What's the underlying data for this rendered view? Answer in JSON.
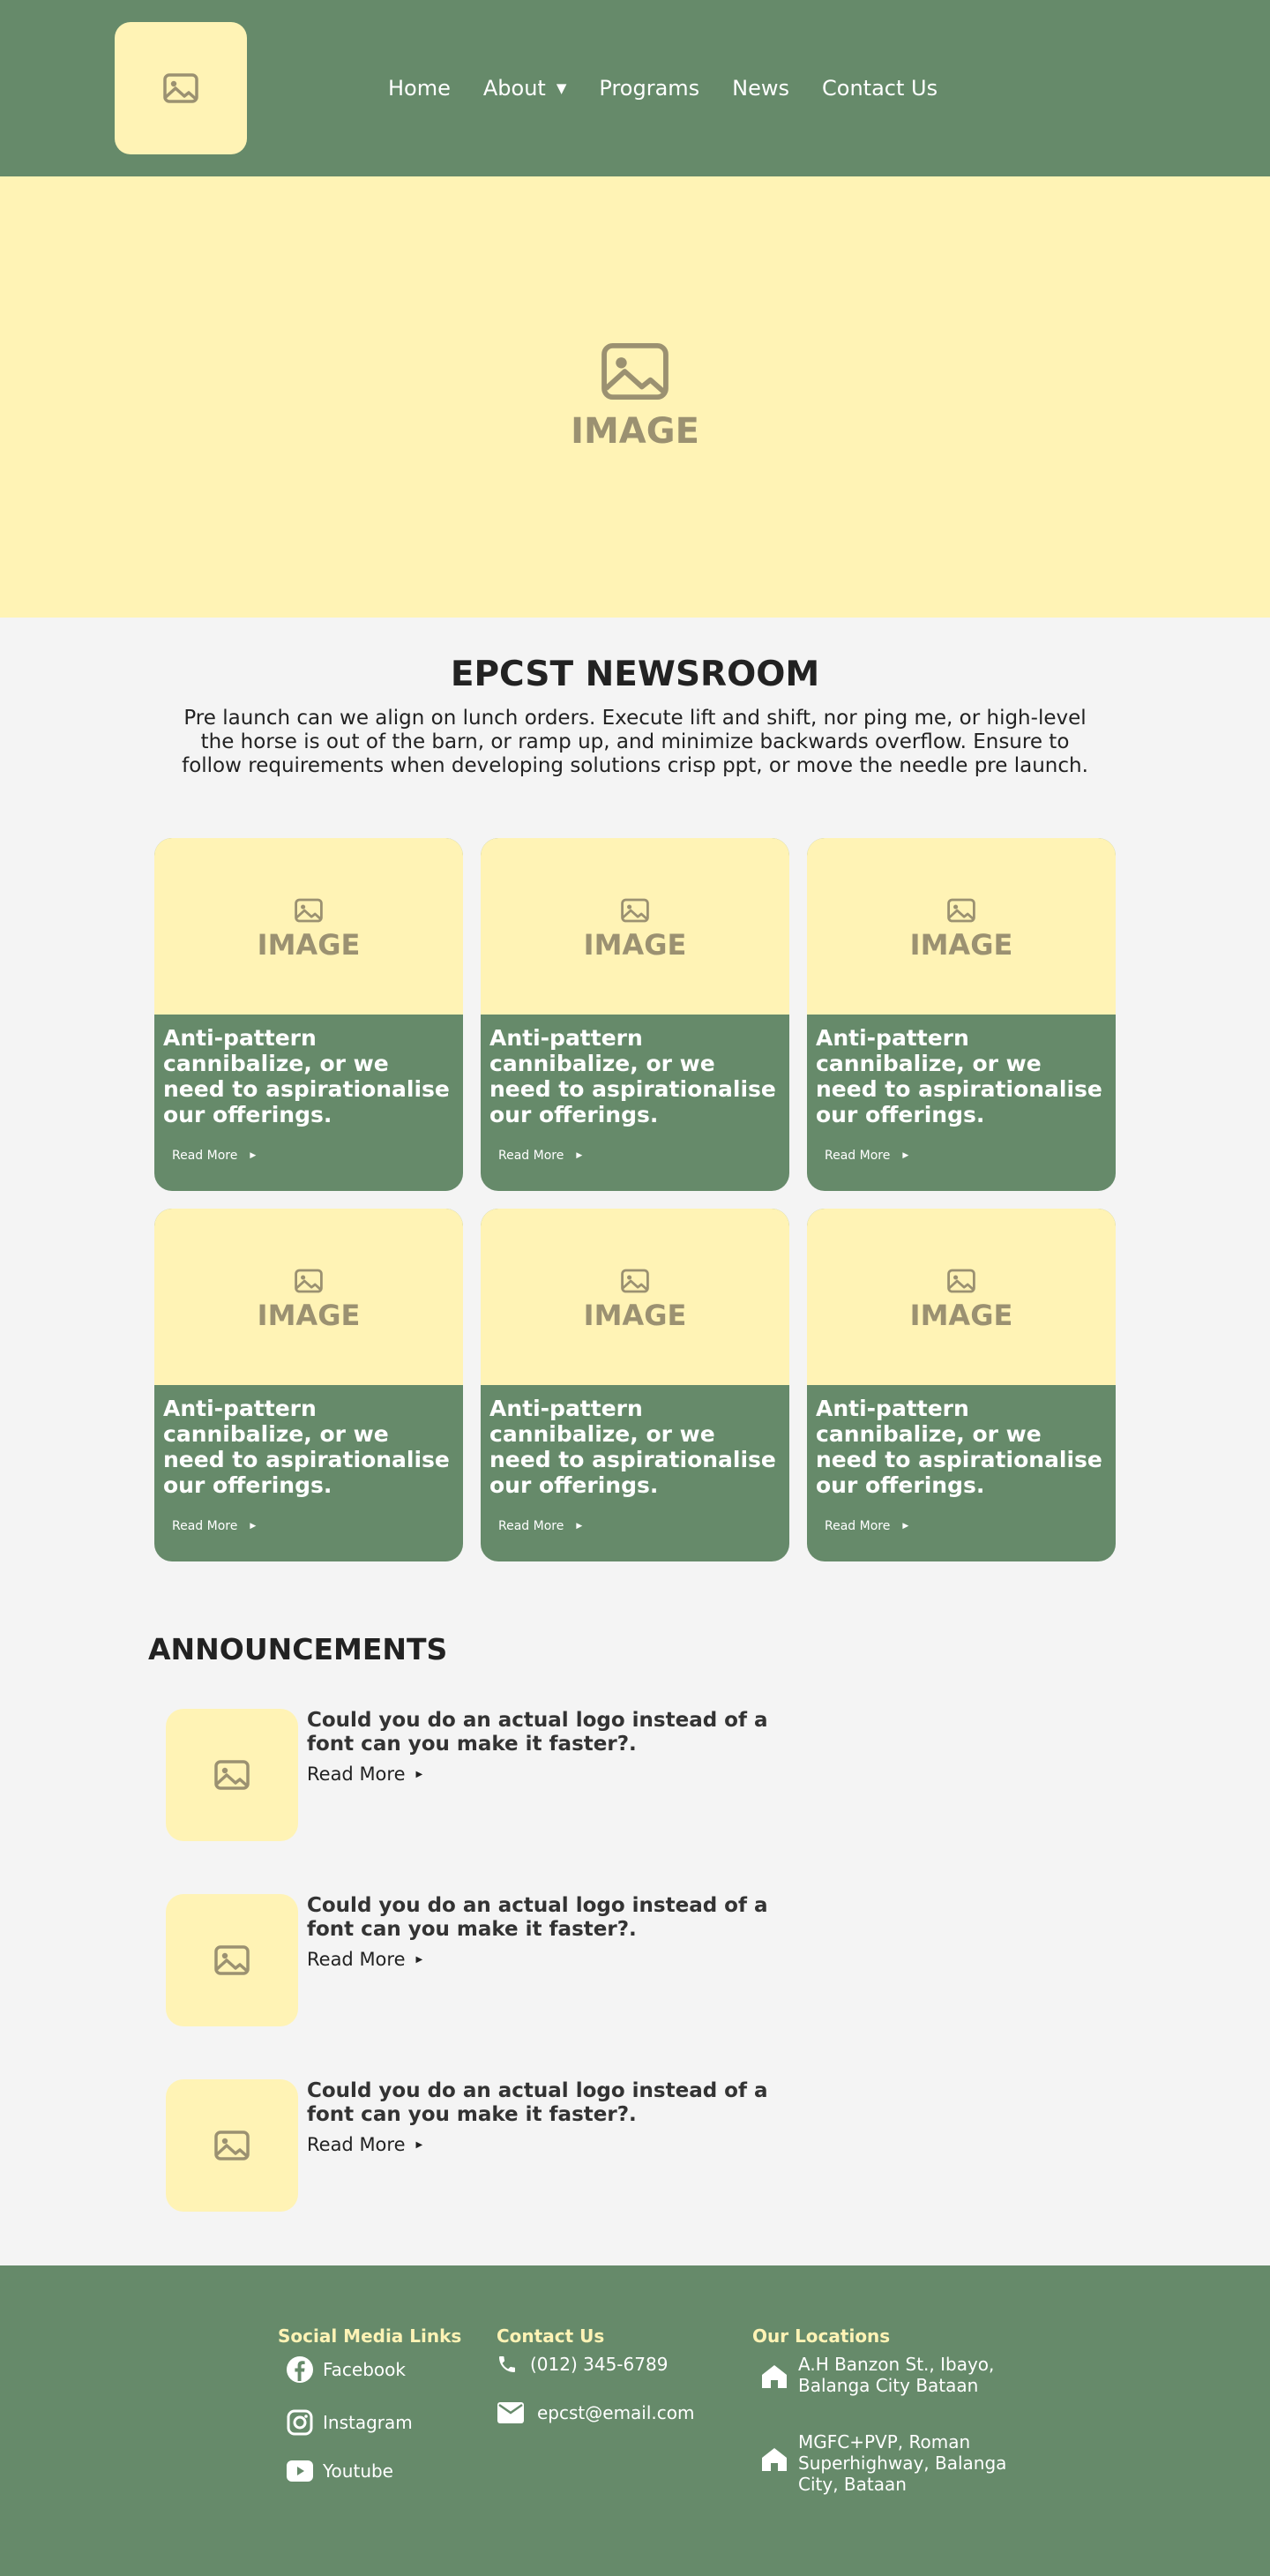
{
  "header": {
    "logo_icon": "image-placeholder-icon",
    "nav": [
      {
        "label": "Home"
      },
      {
        "label": "About",
        "has_dropdown": true
      },
      {
        "label": "Programs"
      },
      {
        "label": "News"
      },
      {
        "label": "Contact Us"
      }
    ]
  },
  "hero": {
    "label": "IMAGE",
    "icon": "image-placeholder-icon"
  },
  "newsroom": {
    "title": "EPCST NEWSROOM",
    "description": "Pre launch can we align on lunch orders. Execute lift and shift, nor ping me, or high-level the horse is out of the barn, or ramp up, and minimize backwards overflow. Ensure to follow requirements when developing solutions crisp ppt, or move the needle pre launch.",
    "cards": [
      {
        "image_label": "IMAGE",
        "title": "Anti-pattern cannibalize, or we need to aspirationalise our offerings.",
        "read_more": "Read More"
      },
      {
        "image_label": "IMAGE",
        "title": "Anti-pattern cannibalize, or we need to aspirationalise our offerings.",
        "read_more": "Read More"
      },
      {
        "image_label": "IMAGE",
        "title": "Anti-pattern cannibalize, or we need to aspirationalise our offerings.",
        "read_more": "Read More"
      },
      {
        "image_label": "IMAGE",
        "title": "Anti-pattern cannibalize, or we need to aspirationalise our offerings.",
        "read_more": "Read More"
      },
      {
        "image_label": "IMAGE",
        "title": "Anti-pattern cannibalize, or we need to aspirationalise our offerings.",
        "read_more": "Read More"
      },
      {
        "image_label": "IMAGE",
        "title": "Anti-pattern cannibalize, or we need to aspirationalise our offerings.",
        "read_more": "Read More"
      }
    ]
  },
  "announcements": {
    "title": "ANNOUNCEMENTS",
    "items": [
      {
        "text": "Could you do an actual logo instead of a font can you make it faster?.",
        "read_more": "Read More"
      },
      {
        "text": "Could you do an actual logo instead of a font can you make it faster?.",
        "read_more": "Read More"
      },
      {
        "text": "Could you do an actual logo instead of a font can you make it faster?.",
        "read_more": "Read More"
      }
    ]
  },
  "footer": {
    "social": {
      "heading": "Social Media Links",
      "links": [
        {
          "label": "Facebook",
          "icon": "facebook-icon"
        },
        {
          "label": "Instagram",
          "icon": "instagram-icon"
        },
        {
          "label": "Youtube",
          "icon": "youtube-icon"
        }
      ]
    },
    "contact": {
      "heading": "Contact Us",
      "phone": "(012) 345-6789",
      "email": "epcst@email.com"
    },
    "locations": {
      "heading": "Our Locations",
      "items": [
        {
          "line1": "A.H Banzon St., Ibayo,",
          "line2": "Balanga City Bataan",
          "line3": ""
        },
        {
          "line1": "MGFC+PVP, Roman",
          "line2": "Superhighway, Balanga",
          "line3": "City, Bataan"
        }
      ]
    }
  },
  "colors": {
    "green": "#668a6a",
    "cream": "#fff3b5",
    "placeholder_gray": "#9b9171",
    "page_bg": "#f4f4f4"
  }
}
